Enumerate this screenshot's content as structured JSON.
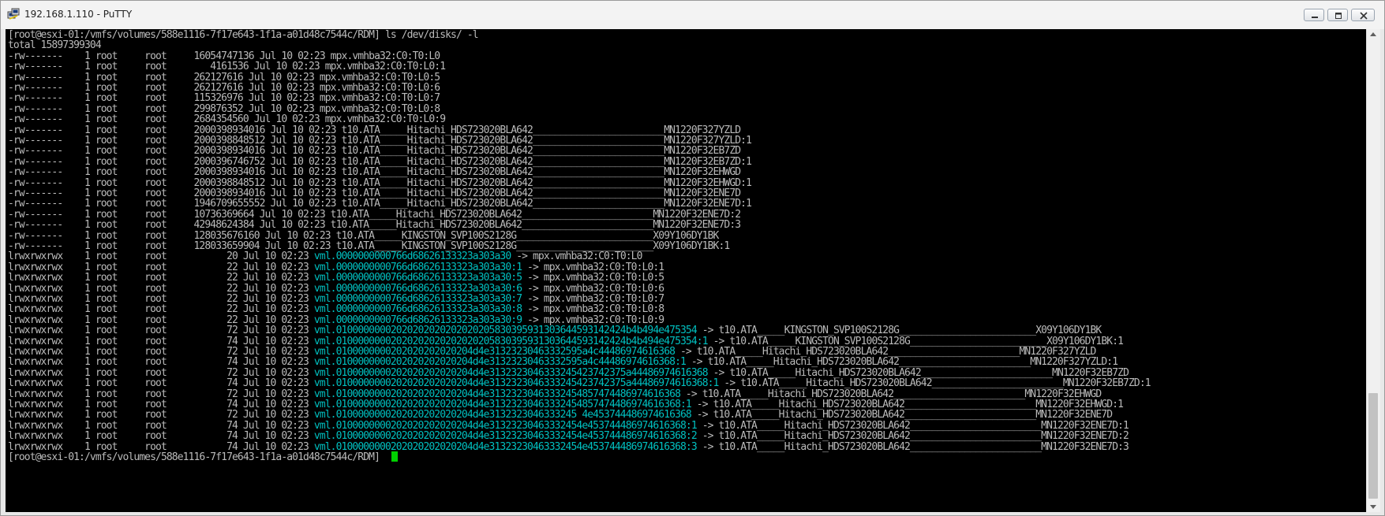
{
  "window": {
    "title": "192.168.1.110 - PuTTY",
    "icons": {
      "app": "putty-icon",
      "minimize": "minimize-icon",
      "maximize": "maximize-icon",
      "close": "close-icon"
    },
    "colors": {
      "terminal_bg": "#000000",
      "text": "#bbbbbb",
      "symlink": "#00c0c0",
      "cursor": "#00d000"
    }
  },
  "terminal": {
    "lines": [
      "[root@esxi-01:/vmfs/volumes/588e1116-7f17e643-1f1a-a01d48c7544c/RDM] ls /dev/disks/ -l",
      "total 15897399304",
      "-rw-------    1 root     root     16054747136 Jul 10 02:23 mpx.vmhba32:C0:T0:L0",
      "-rw-------    1 root     root        4161536 Jul 10 02:23 mpx.vmhba32:C0:T0:L0:1",
      "-rw-------    1 root     root     262127616 Jul 10 02:23 mpx.vmhba32:C0:T0:L0:5",
      "-rw-------    1 root     root     262127616 Jul 10 02:23 mpx.vmhba32:C0:T0:L0:6",
      "-rw-------    1 root     root     115326976 Jul 10 02:23 mpx.vmhba32:C0:T0:L0:7",
      "-rw-------    1 root     root     299876352 Jul 10 02:23 mpx.vmhba32:C0:T0:L0:8",
      "-rw-------    1 root     root     2684354560 Jul 10 02:23 mpx.vmhba32:C0:T0:L0:9",
      "-rw-------    1 root     root     2000398934016 Jul 10 02:23 t10.ATA_____Hitachi_HDS723020BLA642________________________MN1220F327YZLD",
      "-rw-------    1 root     root     2000398848512 Jul 10 02:23 t10.ATA_____Hitachi_HDS723020BLA642________________________MN1220F327YZLD:1",
      "-rw-------    1 root     root     2000398934016 Jul 10 02:23 t10.ATA_____Hitachi_HDS723020BLA642________________________MN1220F32EB7ZD",
      "-rw-------    1 root     root     2000396746752 Jul 10 02:23 t10.ATA_____Hitachi_HDS723020BLA642________________________MN1220F32EB7ZD:1",
      "-rw-------    1 root     root     2000398934016 Jul 10 02:23 t10.ATA_____Hitachi_HDS723020BLA642________________________MN1220F32EHWGD",
      "-rw-------    1 root     root     2000398848512 Jul 10 02:23 t10.ATA_____Hitachi_HDS723020BLA642________________________MN1220F32EHWGD:1",
      "-rw-------    1 root     root     2000398934016 Jul 10 02:23 t10.ATA_____Hitachi_HDS723020BLA642________________________MN1220F32ENE7D",
      "-rw-------    1 root     root     1946709655552 Jul 10 02:23 t10.ATA_____Hitachi_HDS723020BLA642________________________MN1220F32ENE7D:1",
      "-rw-------    1 root     root     10736369664 Jul 10 02:23 t10.ATA_____Hitachi_HDS723020BLA642________________________MN1220F32ENE7D:2",
      "-rw-------    1 root     root     42948624384 Jul 10 02:23 t10.ATA_____Hitachi_HDS723020BLA642________________________MN1220F32ENE7D:3",
      "-rw-------    1 root     root     128035676160 Jul 10 02:23 t10.ATA_____KINGSTON_SVP100S2128G_________________________X09Y106DY1BK",
      "-rw-------    1 root     root     128033659904 Jul 10 02:23 t10.ATA_____KINGSTON_SVP100S2128G_________________________X09Y106DY1BK:1",
      "lrwxrwxrwx    1 root     root           20 Jul 10 02:23 |vml.0000000000766d68626133323a303a30| -> mpx.vmhba32:C0:T0:L0",
      "lrwxrwxrwx    1 root     root           22 Jul 10 02:23 |vml.0000000000766d68626133323a303a30:1| -> mpx.vmhba32:C0:T0:L0:1",
      "lrwxrwxrwx    1 root     root           22 Jul 10 02:23 |vml.0000000000766d68626133323a303a30:5| -> mpx.vmhba32:C0:T0:L0:5",
      "lrwxrwxrwx    1 root     root           22 Jul 10 02:23 |vml.0000000000766d68626133323a303a30:6| -> mpx.vmhba32:C0:T0:L0:6",
      "lrwxrwxrwx    1 root     root           22 Jul 10 02:23 |vml.0000000000766d68626133323a303a30:7| -> mpx.vmhba32:C0:T0:L0:7",
      "lrwxrwxrwx    1 root     root           22 Jul 10 02:23 |vml.0000000000766d68626133323a303a30:8| -> mpx.vmhba32:C0:T0:L0:8",
      "lrwxrwxrwx    1 root     root           22 Jul 10 02:23 |vml.0000000000766d68626133323a303a30:9| -> mpx.vmhba32:C0:T0:L0:9",
      "lrwxrwxrwx    1 root     root           72 Jul 10 02:23 |vml.01000000002020202020202020205830395931303644593142424b4b494e475354| -> t10.ATA_____KINGSTON_SVP100S2128G_________________________X09Y106DY1BK",
      "lrwxrwxrwx    1 root     root           74 Jul 10 02:23 |vml.01000000002020202020202020205830395931303644593142424b4b494e475354:1| -> t10.ATA_____KINGSTON_SVP100S2128G_________________________X09Y106DY1BK:1",
      "lrwxrwxrwx    1 root     root           72 Jul 10 02:23 |vml.0100000000202020202020204d4e31323230463332595a4c44486974616368| -> t10.ATA_____Hitachi_HDS723020BLA642________________________MN1220F327YZLD",
      "lrwxrwxrwx    1 root     root           74 Jul 10 02:23 |vml.0100000000202020202020204d4e31323230463332595a4c44486974616368:1| -> t10.ATA_____Hitachi_HDS723020BLA642________________________MN1220F327YZLD:1",
      "lrwxrwxrwx    1 root     root           72 Jul 10 02:23 |vml.0100000000202020202020204d4e3132323046333245423742375a44486974616368| -> t10.ATA_____Hitachi_HDS723020BLA642________________________MN1220F32EB7ZD",
      "lrwxrwxrwx    1 root     root           74 Jul 10 02:23 |vml.0100000000202020202020204d4e3132323046333245423742375a44486974616368:1| -> t10.ATA_____Hitachi_HDS723020BLA642________________________MN1220F32EB7ZD:1",
      "lrwxrwxrwx    1 root     root           72 Jul 10 02:23 |vml.0100000000202020202020204d4e31323230463332454857474486974616368| -> t10.ATA_____Hitachi_HDS723020BLA642________________________MN1220F32EHWGD",
      "lrwxrwxrwx    1 root     root           74 Jul 10 02:23 |vml.0100000000202020202020204d4e31323230463332454857474486974616368:1| -> t10.ATA_____Hitachi_HDS723020BLA642________________________MN1220F32EHWGD:1",
      "lrwxrwxrwx    1 root     root           72 Jul 10 02:23 |vml.0100000000202020202020204d4e3132323046333245 4e453744486974616368| -> t10.ATA_____Hitachi_HDS723020BLA642________________________MN1220F32ENE7D",
      "lrwxrwxrwx    1 root     root           74 Jul 10 02:23 |vml.0100000000202020202020204d4e31323230463332454e453744486974616368:1| -> t10.ATA_____Hitachi_HDS723020BLA642________________________MN1220F32ENE7D:1",
      "lrwxrwxrwx    1 root     root           74 Jul 10 02:23 |vml.0100000000202020202020204d4e31323230463332454e453744486974616368:2| -> t10.ATA_____Hitachi_HDS723020BLA642________________________MN1220F32ENE7D:2",
      "lrwxrwxrwx    1 root     root           74 Jul 10 02:23 |vml.0100000000202020202020204d4e31323230463332454e453744486974616368:3| -> t10.ATA_____Hitachi_HDS723020BLA642________________________MN1220F32ENE7D:3",
      "[root@esxi-01:/vmfs/volumes/588e1116-7f17e643-1f1a-a01d48c7544c/RDM] "
    ]
  }
}
